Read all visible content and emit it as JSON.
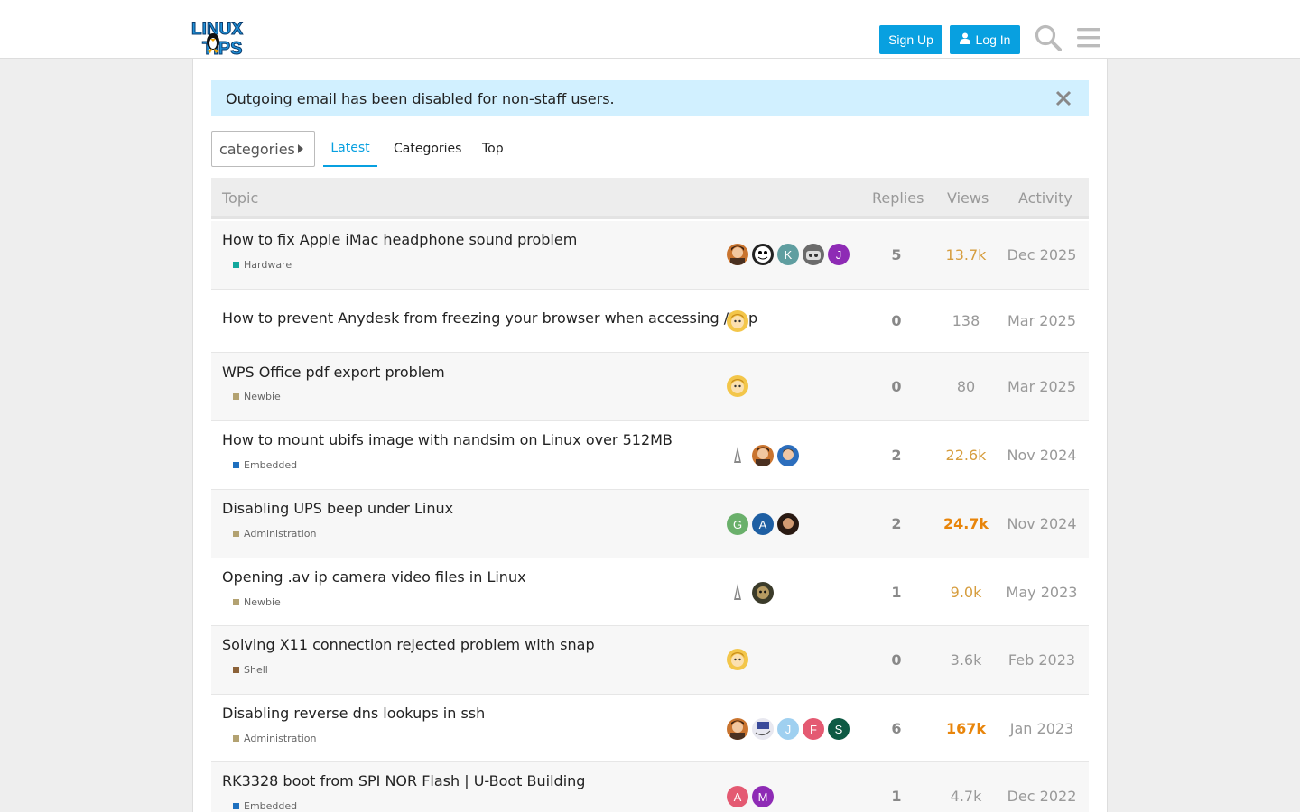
{
  "header": {
    "logo_text_top": "LINUX",
    "logo_text_bottom": "TIPS",
    "signup_label": "Sign Up",
    "login_label": "Log In"
  },
  "alert": {
    "text": "Outgoing email has been disabled for non-staff users."
  },
  "nav": {
    "categories_dropdown": "categories",
    "tabs": [
      {
        "label": "Latest",
        "active": true
      },
      {
        "label": "Categories",
        "active": false
      },
      {
        "label": "Top",
        "active": false
      }
    ]
  },
  "table": {
    "columns": {
      "topic": "Topic",
      "replies": "Replies",
      "views": "Views",
      "activity": "Activity"
    },
    "rows": [
      {
        "title": "How to fix Apple iMac headphone sound problem",
        "category": "Hardware",
        "category_color": "#12a89d",
        "replies": "5",
        "views": "13.7k",
        "activity": "Dec 2025"
      },
      {
        "title": "How to prevent Anydesk from freezing your browser when accessing /tmp",
        "category": "",
        "category_color": "",
        "replies": "0",
        "views": "138",
        "activity": "Mar 2025"
      },
      {
        "title": "WPS Office pdf export problem",
        "category": "Newbie",
        "category_color": "#b3a271",
        "replies": "0",
        "views": "80",
        "activity": "Mar 2025"
      },
      {
        "title": "How to mount ubifs image with nandsim on Linux over 512MB",
        "category": "Embedded",
        "category_color": "#1e70bf",
        "replies": "2",
        "views": "22.6k",
        "activity": "Nov 2024"
      },
      {
        "title": "Disabling UPS beep under Linux",
        "category": "Administration",
        "category_color": "#b3a271",
        "replies": "2",
        "views": "24.7k",
        "activity": "Nov 2024"
      },
      {
        "title": "Opening .av ip camera video files in Linux",
        "category": "Newbie",
        "category_color": "#b3a271",
        "replies": "1",
        "views": "9.0k",
        "activity": "May 2023"
      },
      {
        "title": "Solving X11 connection rejected problem with snap",
        "category": "Shell",
        "category_color": "#8c6238",
        "replies": "0",
        "views": "3.6k",
        "activity": "Feb 2023"
      },
      {
        "title": "Disabling reverse dns lookups in ssh",
        "category": "Administration",
        "category_color": "#b3a271",
        "replies": "6",
        "views": "167k",
        "activity": "Jan 2023"
      },
      {
        "title": "RK3328 boot from SPI NOR Flash | U-Boot Building",
        "category": "Embedded",
        "category_color": "#1e70bf",
        "replies": "1",
        "views": "4.7k",
        "activity": "Dec 2022"
      }
    ]
  },
  "avatar_letters": {
    "r0": [
      "",
      "",
      "K",
      "",
      "J"
    ],
    "r4": [
      "G",
      "A",
      ""
    ],
    "r7": [
      "",
      "",
      "J",
      "F",
      "S"
    ],
    "r8": [
      "A",
      "M"
    ]
  },
  "colors": {
    "accent": "#08a0e0",
    "alert_bg": "#d1f0ff",
    "heat_low": "#d69d3e",
    "heat_high": "#e8850b"
  }
}
